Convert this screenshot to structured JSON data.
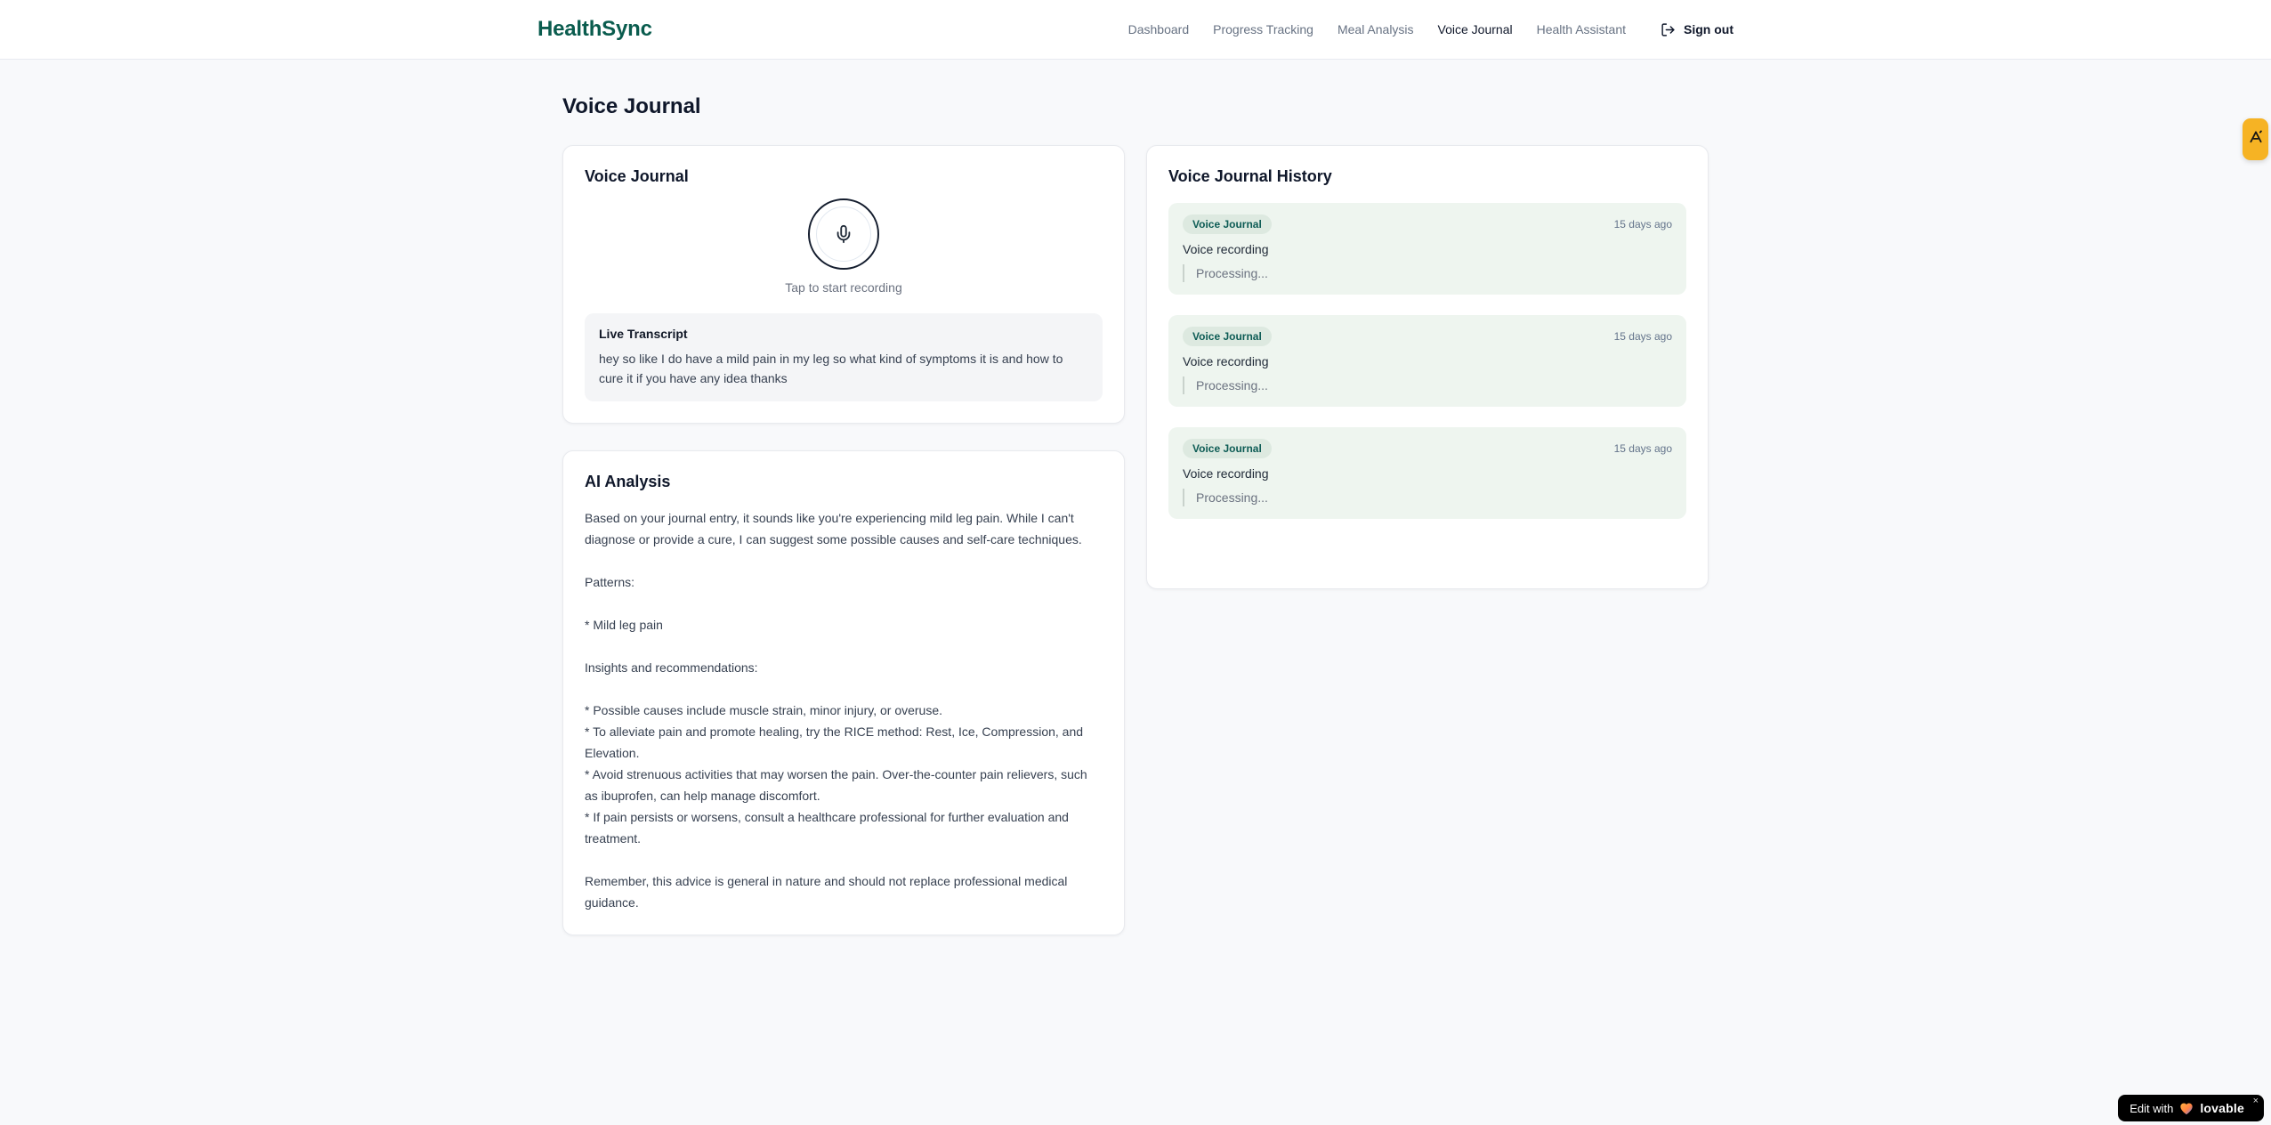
{
  "nav": {
    "brand": "HealthSync",
    "items": [
      {
        "label": "Dashboard"
      },
      {
        "label": "Progress Tracking"
      },
      {
        "label": "Meal Analysis"
      },
      {
        "label": "Voice Journal",
        "active": true
      },
      {
        "label": "Health Assistant"
      }
    ],
    "sign_out": "Sign out"
  },
  "page": {
    "title": "Voice Journal"
  },
  "recorder": {
    "title": "Voice Journal",
    "mic_icon": "microphone-icon",
    "tap_hint": "Tap to start recording",
    "transcript_title": "Live Transcript",
    "transcript_text": "hey so like I do have a mild pain in my leg so what kind of symptoms it is and how to cure it if you have any idea thanks"
  },
  "analysis": {
    "title": "AI Analysis",
    "body": "Based on your journal entry, it sounds like you're experiencing mild leg pain. While I can't diagnose or provide a cure, I can suggest some possible causes and self-care techniques.\n\nPatterns:\n\n* Mild leg pain\n\nInsights and recommendations:\n\n* Possible causes include muscle strain, minor injury, or overuse.\n* To alleviate pain and promote healing, try the RICE method: Rest, Ice, Compression, and Elevation.\n* Avoid strenuous activities that may worsen the pain. Over-the-counter pain relievers, such as ibuprofen, can help manage discomfort.\n* If pain persists or worsens, consult a healthcare professional for further evaluation and treatment.\n\nRemember, this advice is general in nature and should not replace professional medical guidance."
  },
  "history": {
    "title": "Voice Journal History",
    "entries": [
      {
        "badge": "Voice Journal",
        "time": "15 days ago",
        "label": "Voice recording",
        "status": "Processing..."
      },
      {
        "badge": "Voice Journal",
        "time": "15 days ago",
        "label": "Voice recording",
        "status": "Processing..."
      },
      {
        "badge": "Voice Journal",
        "time": "15 days ago",
        "label": "Voice recording",
        "status": "Processing..."
      }
    ]
  },
  "widgets": {
    "side_tab_icon": "amber-logo-icon",
    "lovable": {
      "prefix": "Edit with",
      "heart_icon": "heart-icon",
      "brand": "lovable",
      "close": "×"
    }
  },
  "colors": {
    "brand_green": "#0a5c4e",
    "entry_bg": "#eef5ef",
    "badge_bg": "#dde9e0",
    "badge_text": "#0d5c55",
    "amber_tab": "#f6b324",
    "page_bg": "#f8f9fb"
  }
}
